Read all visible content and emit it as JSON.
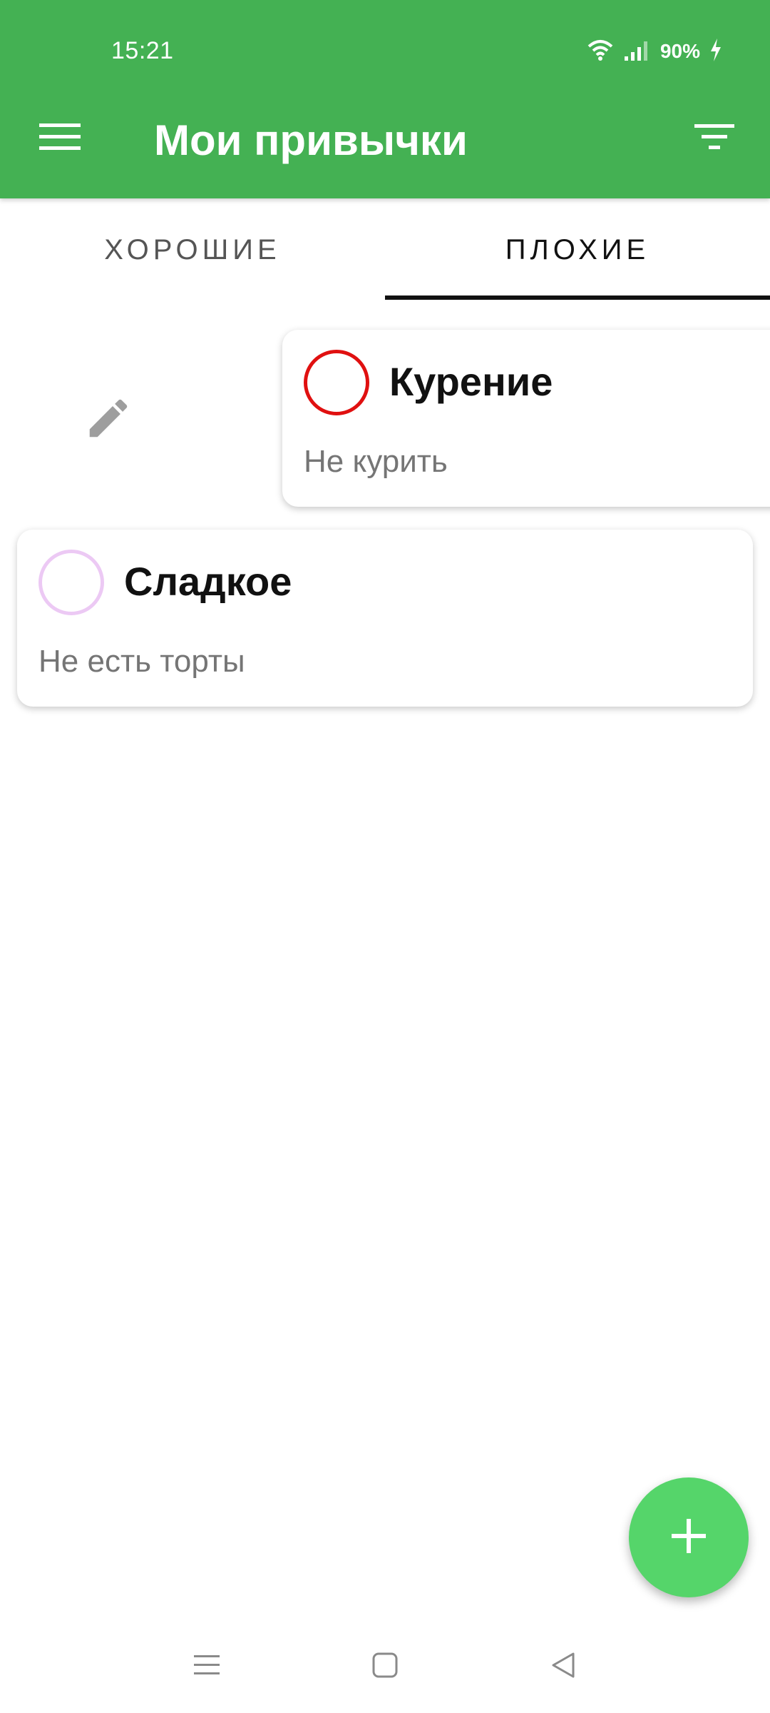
{
  "status_bar": {
    "time": "15:21",
    "battery": "90%",
    "icons": [
      "wifi-icon",
      "signal-icon",
      "charging-icon"
    ]
  },
  "toolbar": {
    "title": "Мои привычки",
    "menu_icon": "menu-icon",
    "filter_icon": "filter-icon",
    "background_color": "#44b153"
  },
  "tabs": [
    {
      "label": "ХОРОШИЕ",
      "active": false
    },
    {
      "label": "ПЛОХИЕ",
      "active": true
    }
  ],
  "swipe_action": {
    "icon": "edit-icon"
  },
  "habits": [
    {
      "title": "Курение",
      "description": "Не курить",
      "color": "#e01010"
    },
    {
      "title": "Сладкое",
      "description": "Не есть торты",
      "color": "#ecc9f4"
    }
  ],
  "fab": {
    "icon": "plus-icon",
    "color": "#55d56a"
  },
  "system_nav": {
    "icons": [
      "recent-apps-icon",
      "home-icon",
      "back-icon"
    ]
  }
}
